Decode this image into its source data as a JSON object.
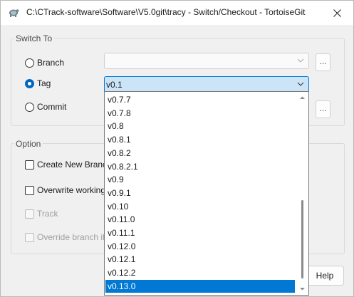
{
  "window": {
    "title": "C:\\CTrack-software\\Software\\V5.0git\\tracy - Switch/Checkout - TortoiseGit",
    "close_icon": "close-icon",
    "app_icon": "tortoisegit-icon"
  },
  "switch_to": {
    "label": "Switch To",
    "branch_label": "Branch",
    "tag_label": "Tag",
    "commit_label": "Commit",
    "selected": "Tag",
    "tag_value": "v0.1",
    "dots_label": "..."
  },
  "option": {
    "label": "Option",
    "create_new_branch_label": "Create New Branch",
    "overwrite_working_label": "Overwrite working",
    "track_label": "Track",
    "override_branch_label": "Override branch if"
  },
  "buttons": {
    "help_label": "Help"
  },
  "tag_dropdown": {
    "items": [
      "v0.7.7",
      "v0.7.8",
      "v0.8",
      "v0.8.1",
      "v0.8.2",
      "v0.8.2.1",
      "v0.9",
      "v0.9.1",
      "v0.10",
      "v0.11.0",
      "v0.11.1",
      "v0.12.0",
      "v0.12.1",
      "v0.12.2",
      "v0.13.0"
    ],
    "selected_index": 14
  },
  "colors": {
    "accent": "#0078d4",
    "combo_active_bg": "#cce4f7"
  }
}
